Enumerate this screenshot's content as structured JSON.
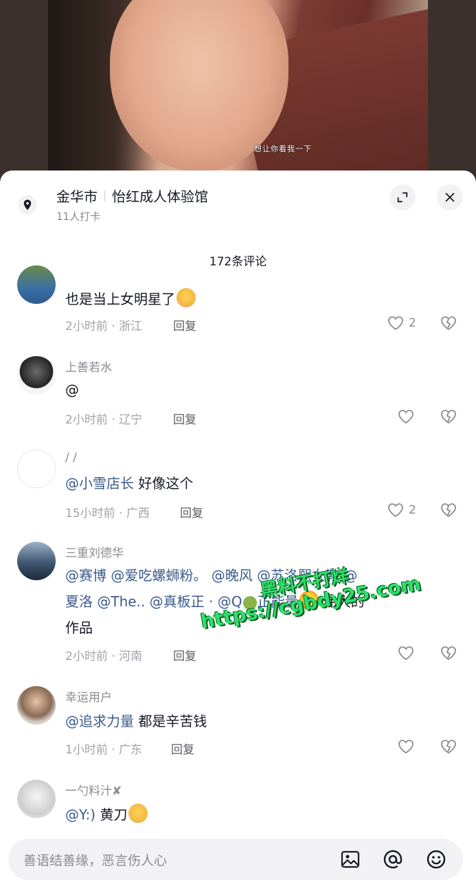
{
  "video": {
    "caption": "想让你看我一下"
  },
  "location": {
    "city": "金华市",
    "place": "怡红成人体验馆",
    "checkins": "11人打卡",
    "icon": "location-pin-icon"
  },
  "header": {
    "comment_count": "172条评论"
  },
  "comments": [
    {
      "username": "",
      "text": "也是当上女明星了",
      "emoji": "hugging-face-emoji",
      "time_loc": "2小时前 · 浙江",
      "reply": "回复",
      "likes": "2"
    },
    {
      "username": "上善若水",
      "text": "@",
      "time_loc": "2小时前 · 辽宁",
      "reply": "回复",
      "likes": ""
    },
    {
      "username": "/ /",
      "mention": "@小雪店长",
      "text": " 好像这个",
      "time_loc": "15小时前 · 广西",
      "reply": "回复",
      "likes": "2"
    },
    {
      "username": "三重刘德华",
      "line1": "@赛博 @爱吃螺蛳粉。 @晚风 @苏洛熙女鞋 @",
      "line2a": "夏洛 @The.. @真板正 · @Q",
      "line2b": "正能量",
      "line2c": " 伟大的",
      "line3": "作品",
      "time_loc": "2小时前 · 河南",
      "reply": "回复",
      "likes": ""
    },
    {
      "username": "幸运用户",
      "mention": "@追求力量",
      "text": " 都是辛苦钱",
      "time_loc": "1小时前 · 广东",
      "reply": "回复",
      "likes": ""
    },
    {
      "username": "一勺料汁✘",
      "mention": "@Y:)",
      "text": " 黄刀",
      "emoji": "crying-face-emoji"
    }
  ],
  "watermark": {
    "line1": "黑料不打烊",
    "line2": "https://cgbdy25.com"
  },
  "input": {
    "placeholder": "善语结善缘，恶言伤人心"
  },
  "colors": {
    "mention": "#3b5a8c",
    "watermark": "#2de06a",
    "muted": "#8a8b91"
  }
}
